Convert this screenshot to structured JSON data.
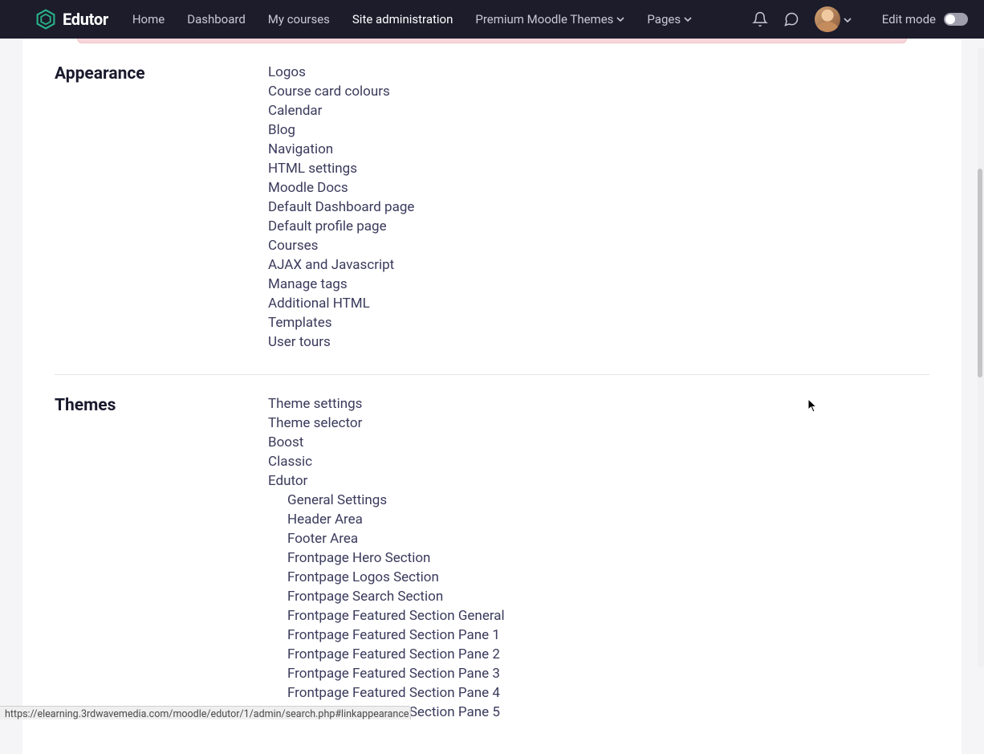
{
  "brand": {
    "name": "Edutor"
  },
  "nav": {
    "home": "Home",
    "dashboard": "Dashboard",
    "my_courses": "My courses",
    "site_admin": "Site administration",
    "premium_themes": "Premium Moodle Themes",
    "pages": "Pages"
  },
  "edit_mode_label": "Edit mode",
  "sections": [
    {
      "title": "Appearance",
      "links": [
        "Logos",
        "Course card colours",
        "Calendar",
        "Blog",
        "Navigation",
        "HTML settings",
        "Moodle Docs",
        "Default Dashboard page",
        "Default profile page",
        "Courses",
        "AJAX and Javascript",
        "Manage tags",
        "Additional HTML",
        "Templates",
        "User tours"
      ]
    },
    {
      "title": "Themes",
      "links": [
        "Theme settings",
        "Theme selector",
        "Boost",
        "Classic",
        "Edutor"
      ],
      "sub_links": [
        "General Settings",
        "Header Area",
        "Footer Area",
        "Frontpage Hero Section",
        "Frontpage Logos Section",
        "Frontpage Search Section",
        "Frontpage Featured Section General",
        "Frontpage Featured Section Pane 1",
        "Frontpage Featured Section Pane 2",
        "Frontpage Featured Section Pane 3",
        "Frontpage Featured Section Pane 4",
        "Frontpage Featured Section Pane 5"
      ]
    }
  ],
  "status_url": "https://elearning.3rdwavemedia.com/moodle/edutor/1/admin/search.php#linkappearance"
}
